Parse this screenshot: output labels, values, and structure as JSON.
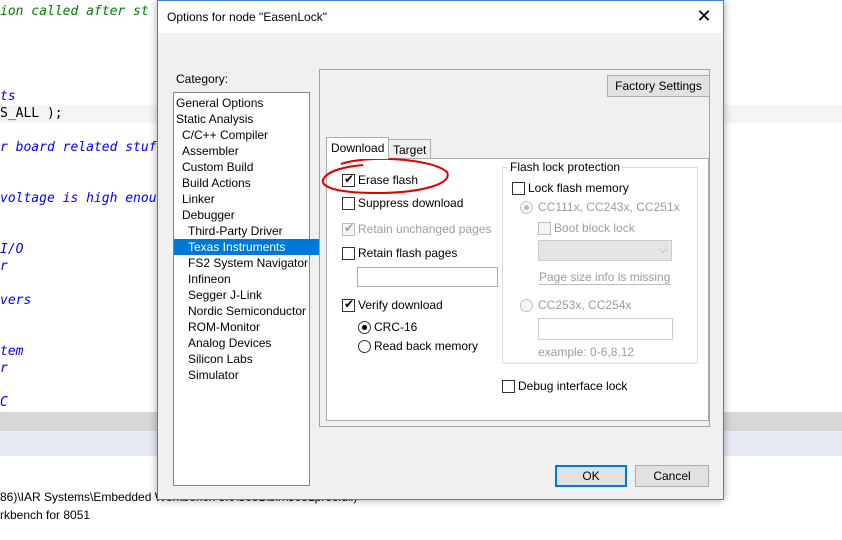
{
  "editor": {
    "lines": [
      {
        "text": "ion called after st",
        "color": "green"
      },
      {
        "text": "ts",
        "color": "blue"
      },
      {
        "text": "S_ALL );",
        "color": "black"
      },
      {
        "text": "r board related stuf",
        "color": "blue"
      },
      {
        "text": "voltage is high enou",
        "color": "blue"
      },
      {
        "text": "I/O",
        "color": "blue"
      },
      {
        "text": "r",
        "color": "blue"
      },
      {
        "text": "vers",
        "color": "blue"
      },
      {
        "text": "tem",
        "color": "blue"
      },
      {
        "text": "r",
        "color": "blue"
      },
      {
        "text": "C",
        "color": "blue"
      }
    ]
  },
  "log": {
    "line1": "86)\\IAR Systems\\Embedded Workbench 8.0\\8051\\bin\\8051proc.dll)",
    "line2": "rkbench for 8051"
  },
  "dialog": {
    "title": "Options for node \"EasenLock\"",
    "close_glyph": "✕",
    "category_label": "Category:",
    "categories": [
      {
        "label": "General Options",
        "indent": 0,
        "selected": false
      },
      {
        "label": "Static Analysis",
        "indent": 0,
        "selected": false
      },
      {
        "label": "C/C++ Compiler",
        "indent": 1,
        "selected": false
      },
      {
        "label": "Assembler",
        "indent": 1,
        "selected": false
      },
      {
        "label": "Custom Build",
        "indent": 1,
        "selected": false
      },
      {
        "label": "Build Actions",
        "indent": 1,
        "selected": false
      },
      {
        "label": "Linker",
        "indent": 1,
        "selected": false
      },
      {
        "label": "Debugger",
        "indent": 1,
        "selected": false
      },
      {
        "label": "Third-Party Driver",
        "indent": 2,
        "selected": false
      },
      {
        "label": "Texas Instruments",
        "indent": 2,
        "selected": true
      },
      {
        "label": "FS2 System Navigator",
        "indent": 2,
        "selected": false
      },
      {
        "label": "Infineon",
        "indent": 2,
        "selected": false
      },
      {
        "label": "Segger J-Link",
        "indent": 2,
        "selected": false
      },
      {
        "label": "Nordic Semiconductor",
        "indent": 2,
        "selected": false
      },
      {
        "label": "ROM-Monitor",
        "indent": 2,
        "selected": false
      },
      {
        "label": "Analog Devices",
        "indent": 2,
        "selected": false
      },
      {
        "label": "Silicon Labs",
        "indent": 2,
        "selected": false
      },
      {
        "label": "Simulator",
        "indent": 2,
        "selected": false
      }
    ],
    "factory_settings": "Factory Settings",
    "tabs": {
      "download": "Download",
      "target": "Target"
    },
    "download": {
      "erase_flash": {
        "label": "Erase flash",
        "checked": true
      },
      "suppress_download": {
        "label": "Suppress download",
        "checked": false
      },
      "retain_unchanged": {
        "label": "Retain unchanged  pages",
        "checked": true,
        "disabled": true
      },
      "retain_flash_pages": {
        "label": "Retain flash pages",
        "checked": false
      },
      "retain_flash_pages_value": "",
      "verify_download": {
        "label": "Verify download",
        "checked": true
      },
      "crc16": {
        "label": "CRC-16",
        "selected": true
      },
      "read_back": {
        "label": "Read back memory",
        "selected": false
      }
    },
    "flash_lock": {
      "group_title": "Flash lock protection",
      "lock_flash_memory": {
        "label": "Lock flash memory",
        "checked": false
      },
      "cc111x": {
        "label": "CC111x, CC243x, CC251x",
        "selected": true
      },
      "boot_block_lock": {
        "label": "Boot block lock",
        "checked": false
      },
      "boot_combo_value": "",
      "page_size_msg": "Page size info is missing",
      "cc253x": {
        "label": "CC253x, CC254x",
        "selected": false
      },
      "pages_value": "",
      "example": "example: 0-6,8,12"
    },
    "debug_interface_lock": {
      "label": "Debug interface lock",
      "checked": false
    },
    "ok": "OK",
    "cancel": "Cancel"
  },
  "colors": {
    "selection": "#0078d7",
    "annotation_red": "#e00000",
    "code_green": "#008000",
    "code_blue": "#0000ff"
  }
}
